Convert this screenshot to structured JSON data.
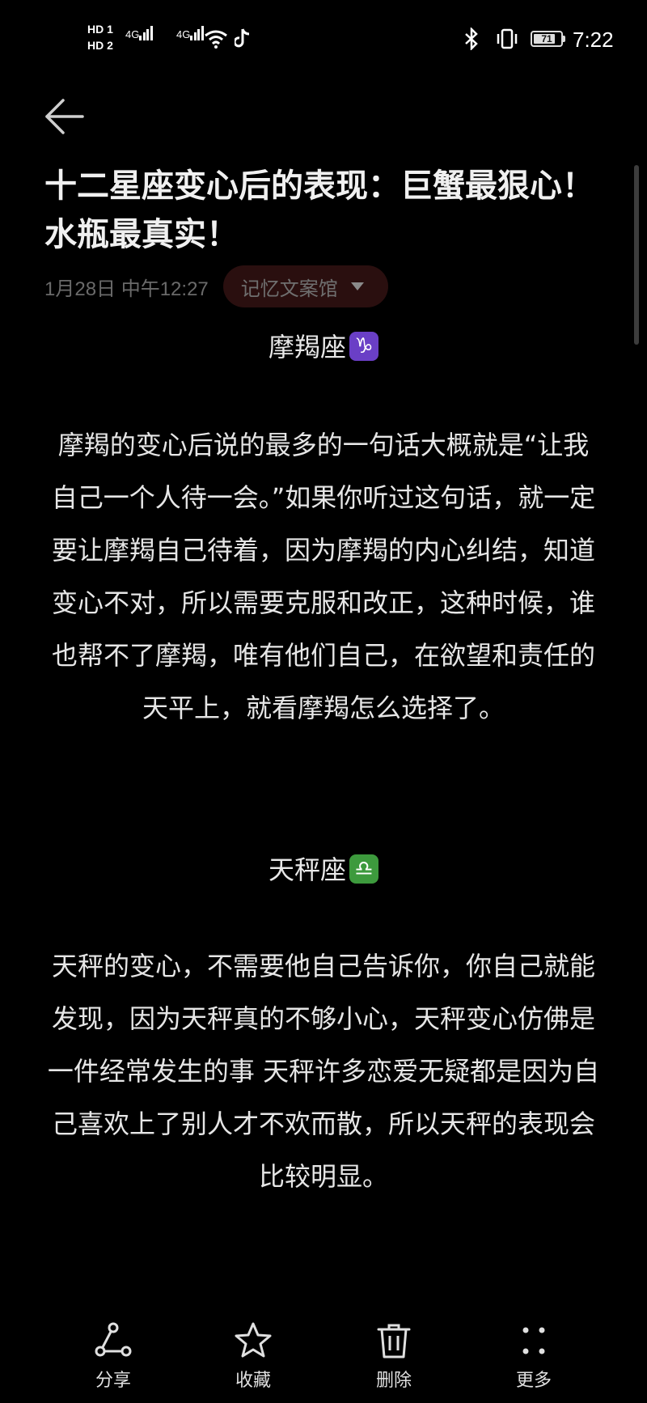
{
  "status_bar": {
    "hd1": "HD 1",
    "hd2": "HD 2",
    "net1": "4G",
    "net2": "4G",
    "battery_level": "71",
    "time": "7:22",
    "icons": [
      "wifi-icon",
      "tiktok-icon",
      "bluetooth-icon",
      "vibrate-icon"
    ]
  },
  "header": {
    "back_icon": "back-arrow-icon"
  },
  "note": {
    "title": "十二星座变心后的表现：巨蟹最狠心！水瓶最真实！",
    "date": "1月28日 中午12:27",
    "folder": "记忆文案馆"
  },
  "sections": [
    {
      "heading": "摩羯座",
      "symbol": "♑",
      "symbol_color": "#6a3fc6",
      "body": "摩羯的变心后说的最多的一句话大概就是“让我自己一个人待一会。”如果你听过这句话，就一定要让摩羯自己待着，因为摩羯的内心纠结，知道变心不对，所以需要克服和改正，这种时候，谁也帮不了摩羯，唯有他们自己，在欲望和责任的天平上，就看摩羯怎么选择了。"
    },
    {
      "heading": "天秤座",
      "symbol": "♎",
      "symbol_color": "#3d9a3d",
      "body": "天秤的变心，不需要他自己告诉你，你自己就能发现，因为天秤真的不够小心，天秤变心仿佛是一件经常发生的事 天秤许多恋爱无疑都是因为自己喜欢上了别人才不欢而散，所以天秤的表现会比较明显。"
    }
  ],
  "toolbar": {
    "share": "分享",
    "favorite": "收藏",
    "delete": "删除",
    "more": "更多"
  },
  "colors": {
    "background": "#000000",
    "text": "#e6e6e6",
    "meta": "#6a6a6a",
    "chip_bg": "#2a0f0f"
  }
}
